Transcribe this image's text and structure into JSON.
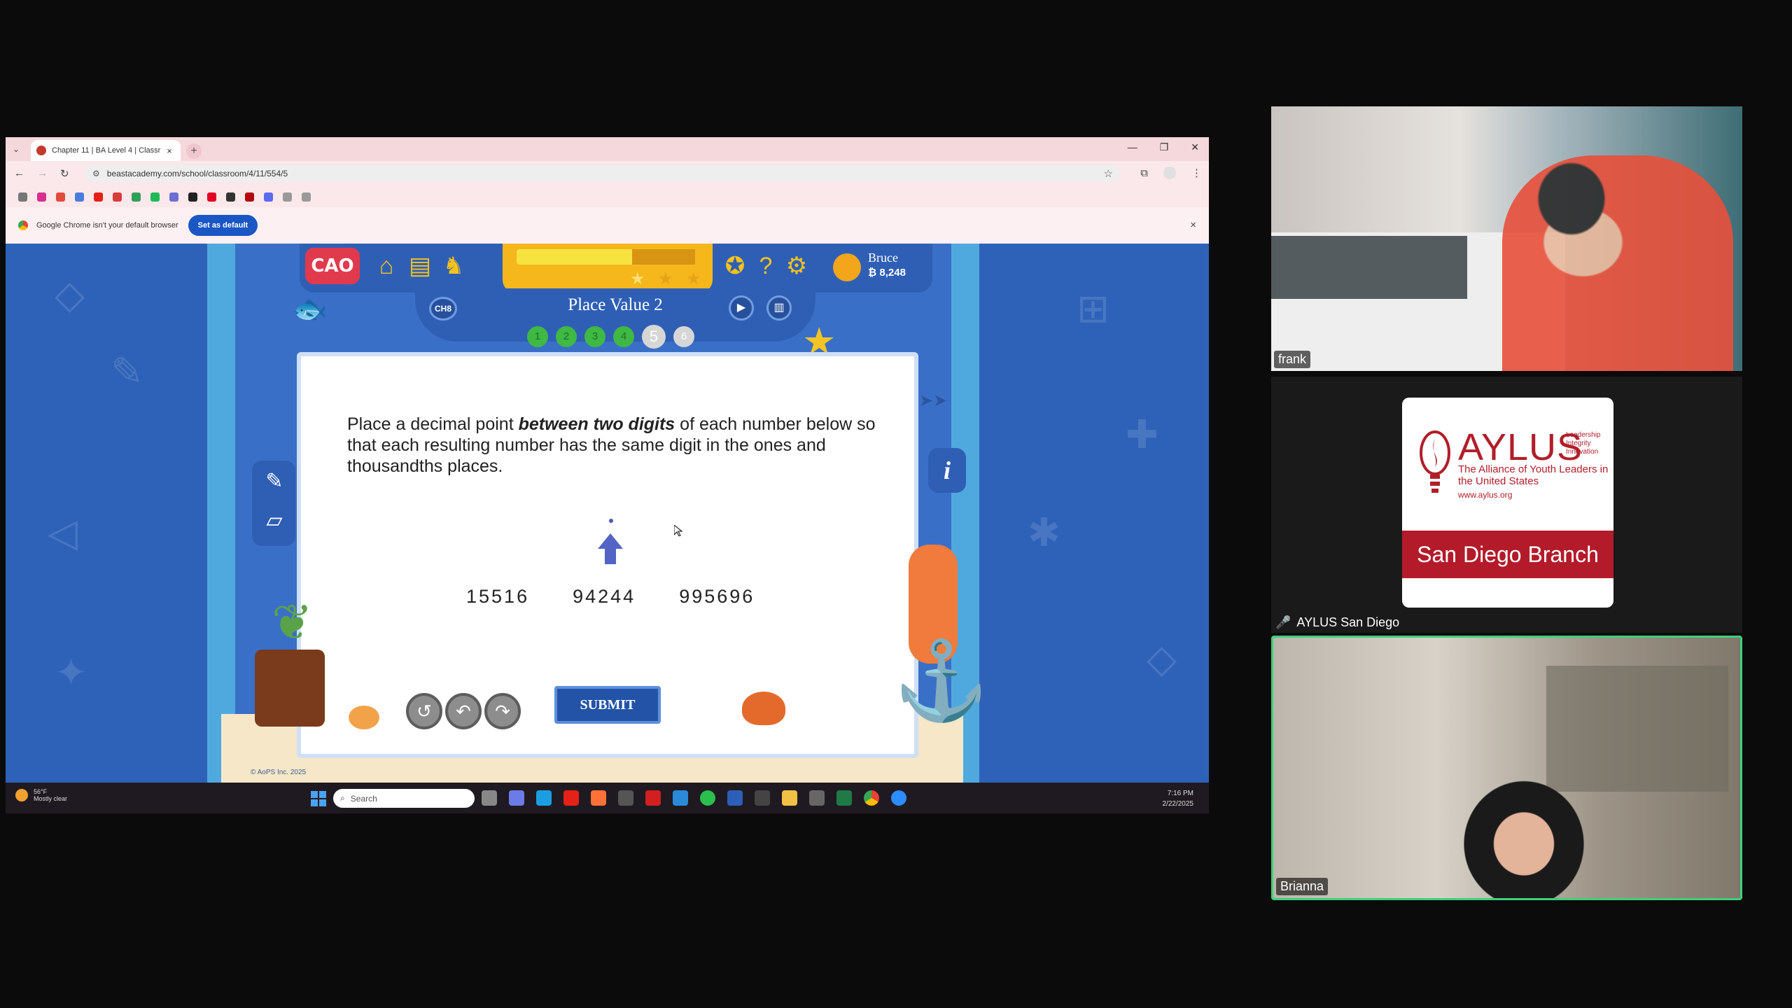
{
  "browser": {
    "tab_title": "Chapter 11 | BA Level 4 | Classr",
    "tab_close": "×",
    "new_tab": "+",
    "url": "beastacademy.com/school/classroom/4/11/554/5",
    "infobar_text": "Google Chrome isn't your default browser",
    "infobar_button": "Set as default",
    "infobar_close": "×"
  },
  "game": {
    "logo": "CAO",
    "progress_stars": 3,
    "user_name": "Bruce",
    "user_coins": "₿ 8,248",
    "chapter_badge": "CH8",
    "lesson_title": "Place Value 2",
    "steps": [
      "1",
      "2",
      "3",
      "4",
      "5",
      "6"
    ],
    "current_step": "5",
    "question_part1": "Place a decimal point ",
    "question_emph": "between two digits",
    "question_part2": " of each number below so that each resulting number has the same digit in the ones and thousandths places.",
    "numbers": [
      "15516",
      "94244",
      "995696"
    ],
    "submit_label": "SUBMIT",
    "info_label": "i",
    "copyright": "© AoPS Inc. 2025"
  },
  "taskbar": {
    "weather_temp": "56°F",
    "weather_desc": "Mostly clear",
    "search_placeholder": "Search",
    "time": "7:16 PM",
    "date": "2/22/2025"
  },
  "participants": {
    "frank": "frank",
    "aylus": "AYLUS San Diego",
    "brianna": "Brianna"
  },
  "aylus_logo": {
    "title": "AYLUS",
    "tagline": [
      "Leadership",
      "Integrity",
      "Innovation"
    ],
    "subtitle": "The Alliance of Youth Leaders in the United States",
    "url": "www.aylus.org",
    "branch": "San Diego Branch"
  },
  "colors": {
    "game_bg": "#2e62b8",
    "game_column": "#4fa9de",
    "submit": "#2353a6",
    "aylus_red": "#b31b2a",
    "active_speaker": "#3ed17a"
  }
}
